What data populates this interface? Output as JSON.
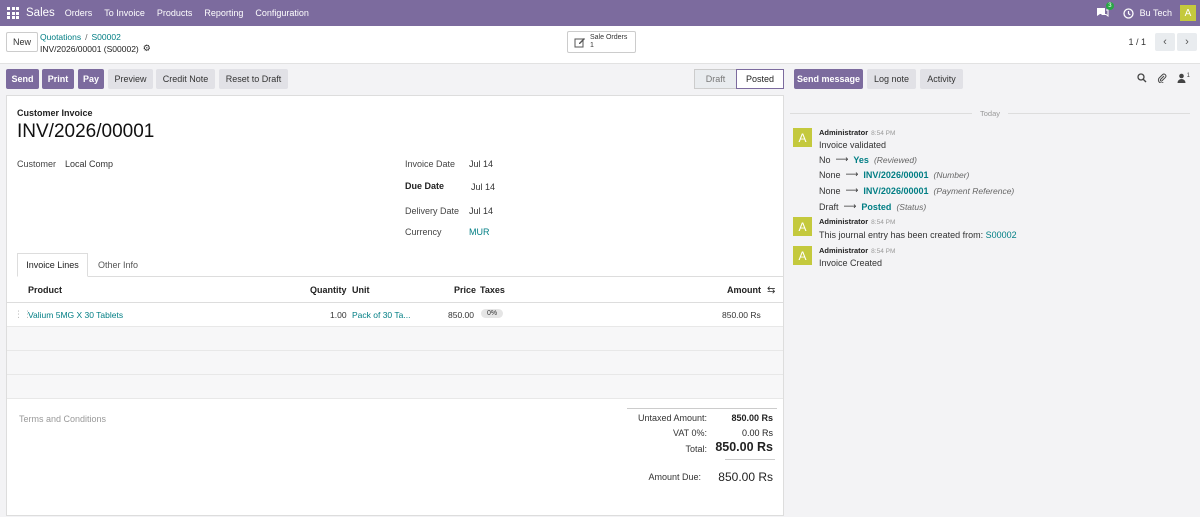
{
  "topnav": {
    "app_name": "Sales",
    "menu": [
      "Orders",
      "To Invoice",
      "Products",
      "Reporting",
      "Configuration"
    ],
    "chat_count": "3",
    "company": "Bu Tech",
    "avatar_letter": "A"
  },
  "control": {
    "new_label": "New",
    "breadcrumb": [
      "Quotations",
      "S00002"
    ],
    "current": "INV/2026/00001 (S00002)",
    "smart_button": {
      "label": "Sale Orders",
      "count": "1"
    },
    "pager": "1 / 1"
  },
  "actions": {
    "buttons": [
      "Send",
      "Print",
      "Pay",
      "Preview",
      "Credit Note",
      "Reset to Draft"
    ],
    "status": [
      "Draft",
      "Posted"
    ]
  },
  "chatter_header": {
    "send_message": "Send message",
    "log_note": "Log note",
    "activity": "Activity",
    "followers_count": "1"
  },
  "form": {
    "doc_type": "Customer Invoice",
    "doc_name": "INV/2026/00001",
    "customer_label": "Customer",
    "customer_value": "Local Comp",
    "invoice_date_label": "Invoice Date",
    "invoice_date_value": "Jul 14",
    "due_date_label": "Due Date",
    "due_date_value": "Jul 14",
    "delivery_date_label": "Delivery Date",
    "delivery_date_value": "Jul 14",
    "currency_label": "Currency",
    "currency_value": "MUR",
    "tabs": [
      "Invoice Lines",
      "Other Info"
    ],
    "columns": [
      "Product",
      "Quantity",
      "Unit",
      "Price",
      "Taxes",
      "Amount"
    ],
    "lines": [
      {
        "product": "Valium 5MG X 30 Tablets",
        "quantity": "1.00",
        "unit": "Pack of 30 Ta...",
        "price": "850.00",
        "taxes": "0%",
        "amount": "850.00 Rs"
      }
    ],
    "terms_placeholder": "Terms and Conditions",
    "totals": {
      "untaxed_label": "Untaxed Amount:",
      "untaxed_value": "850.00 Rs",
      "vat_label": "VAT 0%:",
      "vat_value": "0.00 Rs",
      "total_label": "Total:",
      "total_value": "850.00 Rs",
      "due_label": "Amount Due:",
      "due_value": "850.00 Rs"
    }
  },
  "chatter": {
    "today": "Today",
    "messages": [
      {
        "avatar": "A",
        "author": "Administrator",
        "time": "8:54 PM",
        "text": "Invoice validated",
        "tracking": [
          {
            "old": "No",
            "new": "Yes",
            "field": "(Reviewed)"
          },
          {
            "old": "None",
            "new": "INV/2026/00001",
            "field": "(Number)"
          },
          {
            "old": "None",
            "new": "INV/2026/00001",
            "field": "(Payment Reference)"
          },
          {
            "old": "Draft",
            "new": "Posted",
            "field": "(Status)"
          }
        ]
      },
      {
        "avatar": "A",
        "author": "Administrator",
        "time": "8:54 PM",
        "text": "This journal entry has been created from: ",
        "link": "S00002"
      },
      {
        "avatar": "A",
        "author": "Administrator",
        "time": "8:54 PM",
        "text": "Invoice Created"
      }
    ]
  }
}
